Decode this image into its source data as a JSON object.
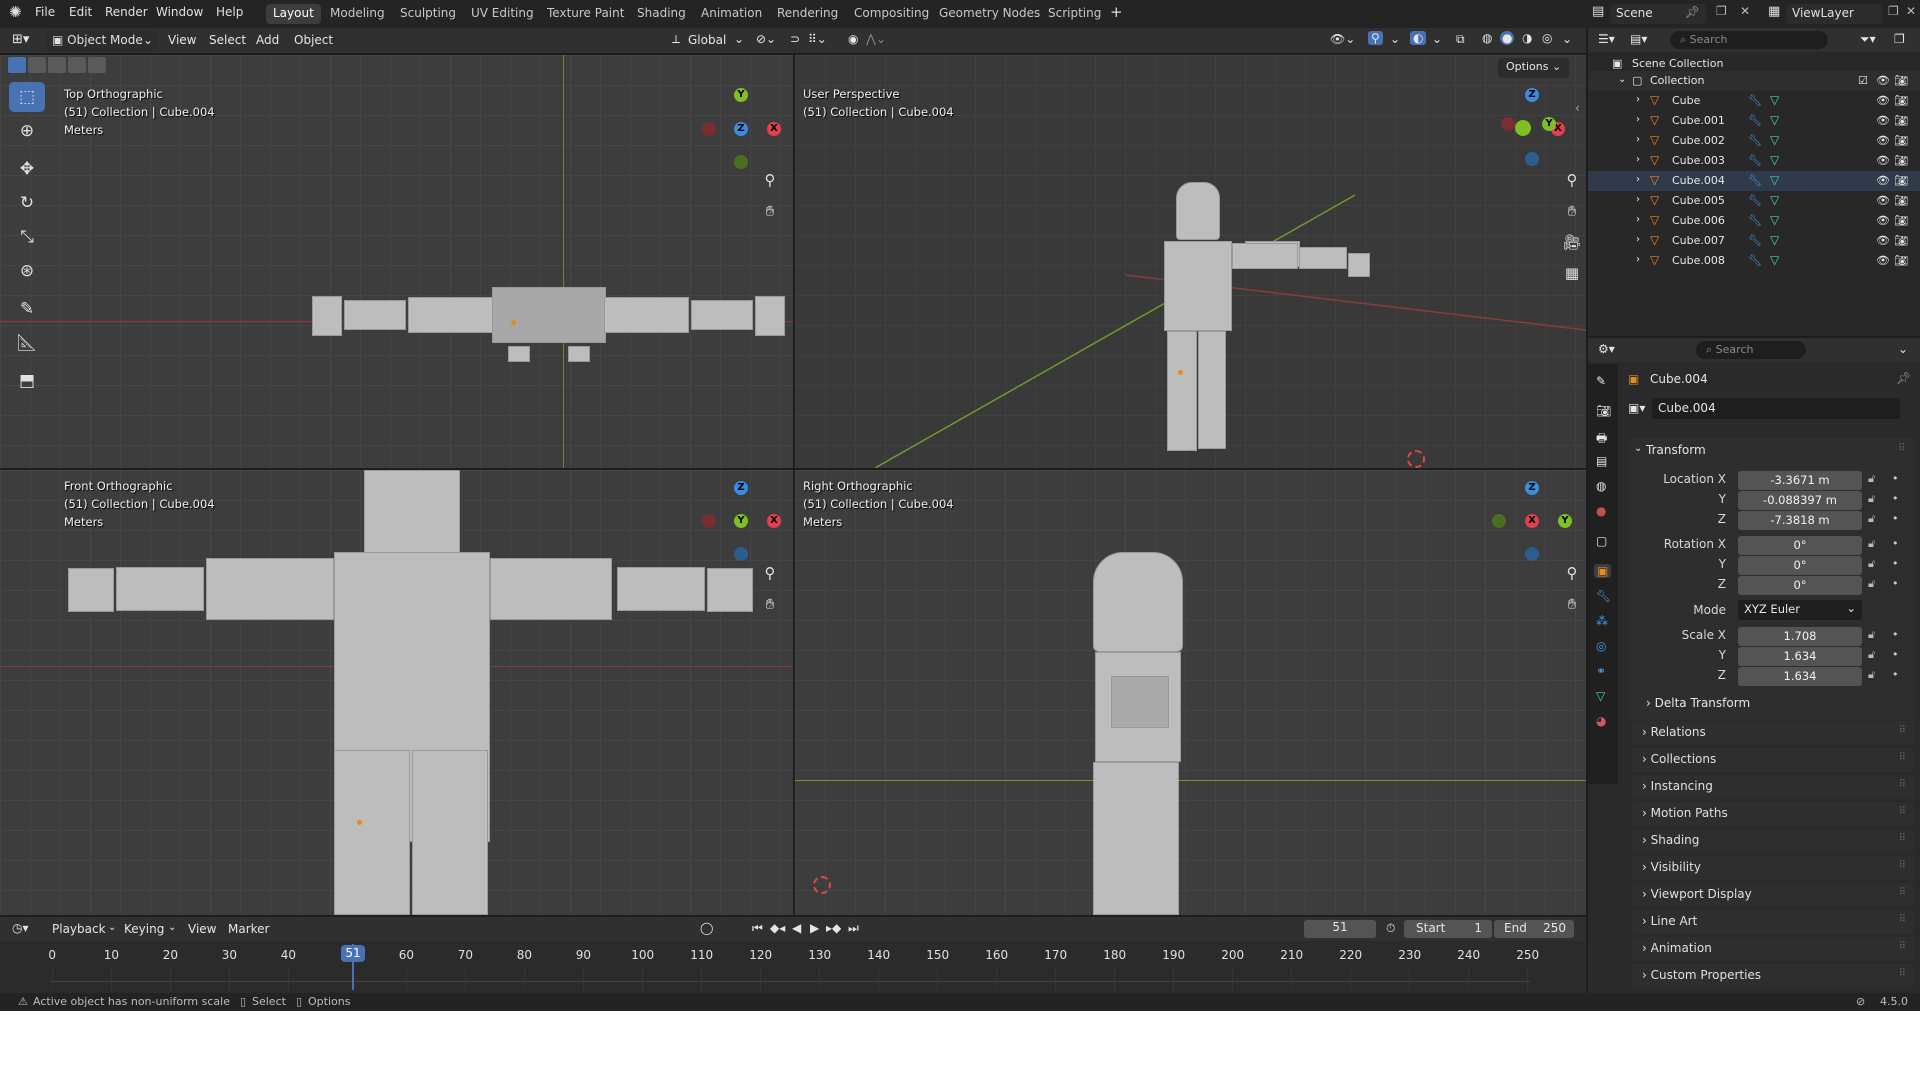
{
  "menu": [
    "File",
    "Edit",
    "Render",
    "Window",
    "Help"
  ],
  "workspaces": [
    {
      "label": "Layout",
      "active": true
    },
    {
      "label": "Modeling"
    },
    {
      "label": "Sculpting"
    },
    {
      "label": "UV Editing"
    },
    {
      "label": "Texture Paint"
    },
    {
      "label": "Shading"
    },
    {
      "label": "Animation"
    },
    {
      "label": "Rendering"
    },
    {
      "label": "Compositing"
    },
    {
      "label": "Geometry Nodes"
    },
    {
      "label": "Scripting"
    }
  ],
  "add_workspace": "+",
  "scene": {
    "label": "Scene",
    "viewlayer": "ViewLayer"
  },
  "viewport_header": {
    "mode": "Object Mode",
    "menus": [
      "View",
      "Select",
      "Add",
      "Object"
    ],
    "orientation": "Global",
    "options": "Options"
  },
  "views": [
    {
      "title": "Top Orthographic",
      "collection": "(51) Collection | Cube.004",
      "units": "Meters"
    },
    {
      "title": "User Perspective",
      "collection": "(51) Collection | Cube.004",
      "units": ""
    },
    {
      "title": "Front Orthographic",
      "collection": "(51) Collection | Cube.004",
      "units": "Meters"
    },
    {
      "title": "Right Orthographic",
      "collection": "(51) Collection | Cube.004",
      "units": "Meters"
    }
  ],
  "gizmo_axes": {
    "x": "X",
    "y": "Y",
    "z": "Z"
  },
  "outliner": {
    "search_placeholder": "Search",
    "scene_collection": "Scene Collection",
    "collection": "Collection",
    "objects": [
      "Cube",
      "Cube.001",
      "Cube.002",
      "Cube.003",
      "Cube.004",
      "Cube.005",
      "Cube.006",
      "Cube.007",
      "Cube.008"
    ],
    "active": "Cube.004"
  },
  "properties": {
    "search_placeholder": "Search",
    "object_name": "Cube.004",
    "name_field": "Cube.004",
    "transform_label": "Transform",
    "location": {
      "label_x": "Location X",
      "label_y": "Y",
      "label_z": "Z",
      "x": "-3.3671 m",
      "y": "-0.088397 m",
      "z": "-7.3818 m"
    },
    "rotation": {
      "label_x": "Rotation X",
      "label_y": "Y",
      "label_z": "Z",
      "x": "0°",
      "y": "0°",
      "z": "0°"
    },
    "mode_label": "Mode",
    "mode_value": "XYZ Euler",
    "scale": {
      "label_x": "Scale X",
      "label_y": "Y",
      "label_z": "Z",
      "x": "1.708",
      "y": "1.634",
      "z": "1.634"
    },
    "delta_transform": "Delta Transform",
    "panels": [
      "Relations",
      "Collections",
      "Instancing",
      "Motion Paths",
      "Shading",
      "Visibility",
      "Viewport Display",
      "Line Art",
      "Animation",
      "Custom Properties"
    ]
  },
  "timeline": {
    "menus": [
      "Playback",
      "Keying",
      "View",
      "Marker"
    ],
    "current_frame": "51",
    "start_label": "Start",
    "start": "1",
    "end_label": "End",
    "end": "250",
    "ticks": [
      "0",
      "10",
      "20",
      "30",
      "40",
      "60",
      "70",
      "80",
      "90",
      "100",
      "110",
      "120",
      "130",
      "140",
      "150",
      "160",
      "170",
      "180",
      "190",
      "200",
      "210",
      "220",
      "230",
      "240",
      "250"
    ],
    "playhead": "51"
  },
  "status": {
    "warning": "Active object has non-uniform scale",
    "select": "Select",
    "options": "Options",
    "version": "4.5.0"
  }
}
